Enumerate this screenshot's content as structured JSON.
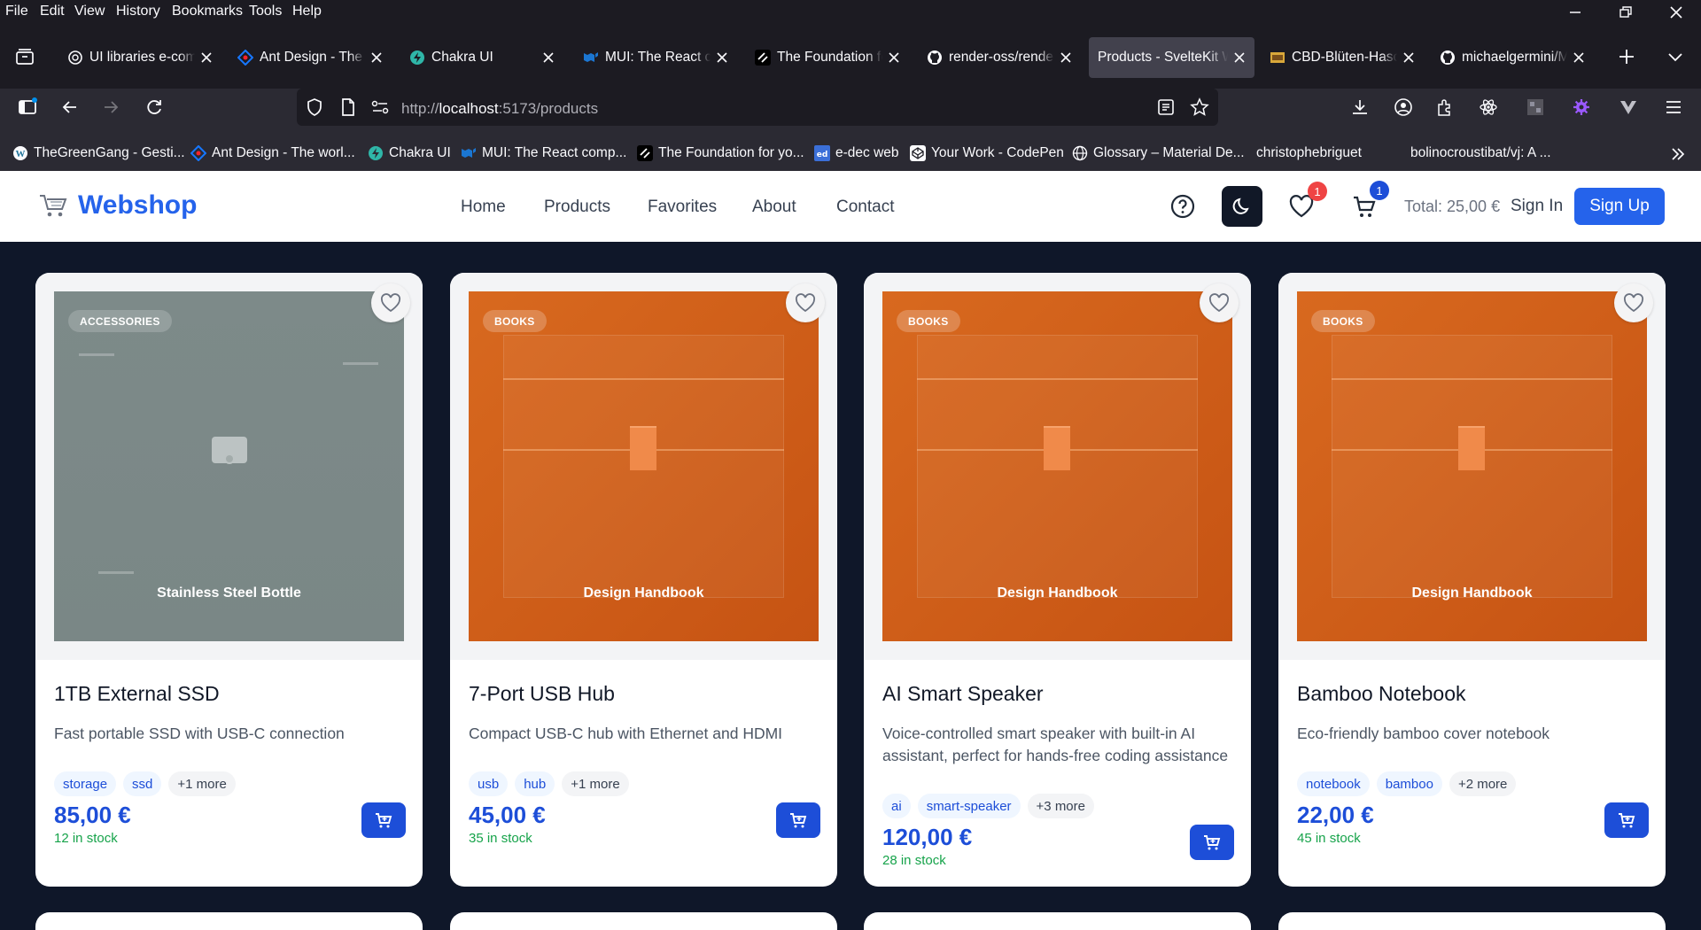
{
  "menu": [
    "File",
    "Edit",
    "View",
    "History",
    "Bookmarks",
    "Tools",
    "Help"
  ],
  "tabs": [
    {
      "title": "UI libraries e-comm",
      "icon": "openai-icon"
    },
    {
      "title": "Ant Design - The wo",
      "icon": "ant-design-icon"
    },
    {
      "title": "Chakra UI",
      "icon": "chakra-icon"
    },
    {
      "title": "MUI: The React com",
      "icon": "mui-icon"
    },
    {
      "title": "The Foundation for",
      "icon": "shadcn-icon"
    },
    {
      "title": "render-oss/render",
      "icon": "github-icon"
    },
    {
      "title": "Products - SvelteKit W",
      "icon": "none"
    },
    {
      "title": "CBD-Blüten-Hasch",
      "icon": "shop-icon"
    },
    {
      "title": "michaelgermini/M",
      "icon": "github-icon"
    }
  ],
  "url": {
    "prefix": "http://",
    "host": "localhost",
    "rest": ":5173/products"
  },
  "bookmarks": [
    {
      "label": "TheGreenGang - Gesti...",
      "icon": "wordpress-icon"
    },
    {
      "label": "Ant Design - The worl...",
      "icon": "ant-design-icon"
    },
    {
      "label": "Chakra UI",
      "icon": "chakra-icon"
    },
    {
      "label": "MUI: The React comp...",
      "icon": "mui-icon"
    },
    {
      "label": "The Foundation for yo...",
      "icon": "shadcn-icon"
    },
    {
      "label": "e-dec web",
      "icon": "edec-icon"
    },
    {
      "label": "Your Work - CodePen",
      "icon": "codepen-icon"
    },
    {
      "label": "Glossary – Material De...",
      "icon": "globe-icon"
    },
    {
      "label": "christophebriguet",
      "icon": "none"
    },
    {
      "label": "bolinocroustibat/vj: A ...",
      "icon": "none"
    }
  ],
  "site": {
    "logo": "Webshop",
    "nav": [
      "Home",
      "Products",
      "Favorites",
      "About",
      "Contact"
    ],
    "favorites_count": "1",
    "cart_count": "1",
    "total": "Total: 25,00 €",
    "sign_in": "Sign In",
    "sign_up": "Sign Up",
    "brand_color": "#2563eb"
  },
  "products": [
    {
      "category": "ACCESSORIES",
      "image_caption": "Stainless Steel Bottle",
      "image_color": "#7d8a89",
      "name": "1TB External SSD",
      "description": "Fast portable SSD with USB-C connection",
      "tags": [
        "storage",
        "ssd"
      ],
      "more": "+1 more",
      "price": "85,00 €",
      "stock": "12 in stock"
    },
    {
      "category": "BOOKS",
      "image_caption": "Design Handbook",
      "image_color": "#cf5f19",
      "name": "7-Port USB Hub",
      "description": "Compact USB-C hub with Ethernet and HDMI",
      "tags": [
        "usb",
        "hub"
      ],
      "more": "+1 more",
      "price": "45,00 €",
      "stock": "35 in stock"
    },
    {
      "category": "BOOKS",
      "image_caption": "Design Handbook",
      "image_color": "#cf5f19",
      "name": "AI Smart Speaker",
      "description": "Voice-controlled smart speaker with built-in AI assistant, perfect for hands-free coding assistance",
      "tags": [
        "ai",
        "smart-speaker"
      ],
      "more": "+3 more",
      "price": "120,00 €",
      "stock": "28 in stock"
    },
    {
      "category": "BOOKS",
      "image_caption": "Design Handbook",
      "image_color": "#cf5f19",
      "name": "Bamboo Notebook",
      "description": "Eco-friendly bamboo cover notebook",
      "tags": [
        "notebook",
        "bamboo"
      ],
      "more": "+2 more",
      "price": "22,00 €",
      "stock": "45 in stock"
    }
  ]
}
